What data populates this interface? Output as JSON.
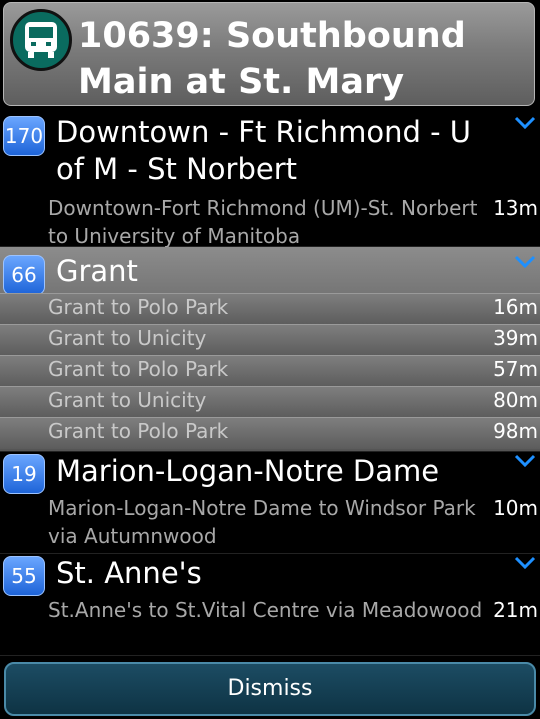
{
  "header": {
    "title": "10639: Southbound Main at St. Mary",
    "icon": "bus-icon"
  },
  "routes": [
    {
      "number": "170",
      "name": "Downtown - Ft Richmond - U of M - St Norbert",
      "departures": [
        {
          "dest": "Downtown-Fort Richmond (UM)-St. Norbert to University of Manitoba",
          "mins": "13m"
        }
      ]
    },
    {
      "number": "66",
      "name": "Grant",
      "departures": [
        {
          "dest": "Grant to Polo Park",
          "mins": "16m"
        },
        {
          "dest": "Grant to Unicity",
          "mins": "39m"
        },
        {
          "dest": "Grant to Polo Park",
          "mins": "57m"
        },
        {
          "dest": "Grant to Unicity",
          "mins": "80m"
        },
        {
          "dest": "Grant to Polo Park",
          "mins": "98m"
        }
      ]
    },
    {
      "number": "19",
      "name": "Marion-Logan-Notre Dame",
      "departures": [
        {
          "dest": "Marion-Logan-Notre Dame to Windsor Park via Autumnwood",
          "mins": "10m"
        }
      ]
    },
    {
      "number": "55",
      "name": "St. Anne's",
      "departures": [
        {
          "dest": "St.Anne's to St.Vital Centre via Meadowood",
          "mins": "21m"
        }
      ]
    }
  ],
  "dismiss_label": "Dismiss",
  "colors": {
    "accent": "#1e64d8",
    "chevron": "#1e90ff",
    "header": "#7b7b7b",
    "button": "#1c4c63"
  }
}
